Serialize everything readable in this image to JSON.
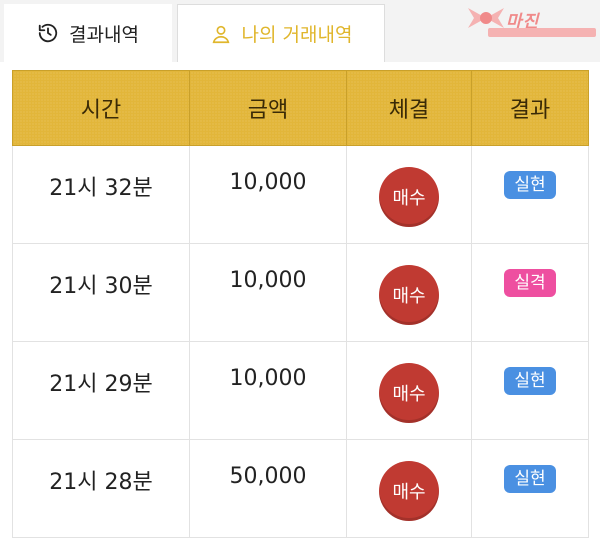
{
  "tabs": {
    "history_label": "결과내역",
    "my_label": "나의 거래내역"
  },
  "logo": {
    "text": "마진"
  },
  "colors": {
    "accent": "#e2b63a",
    "buy": "#c03a32",
    "win": "#4a90e2",
    "lose": "#ee4fa0"
  },
  "table": {
    "headers": [
      "시간",
      "금액",
      "체결",
      "결과"
    ],
    "rows": [
      {
        "time": "21시 32분",
        "amount": "10,000",
        "trade": "매수",
        "result": "실현",
        "status": "win"
      },
      {
        "time": "21시 30분",
        "amount": "10,000",
        "trade": "매수",
        "result": "실격",
        "status": "lose"
      },
      {
        "time": "21시 29분",
        "amount": "10,000",
        "trade": "매수",
        "result": "실현",
        "status": "win"
      },
      {
        "time": "21시 28분",
        "amount": "50,000",
        "trade": "매수",
        "result": "실현",
        "status": "win"
      }
    ]
  }
}
